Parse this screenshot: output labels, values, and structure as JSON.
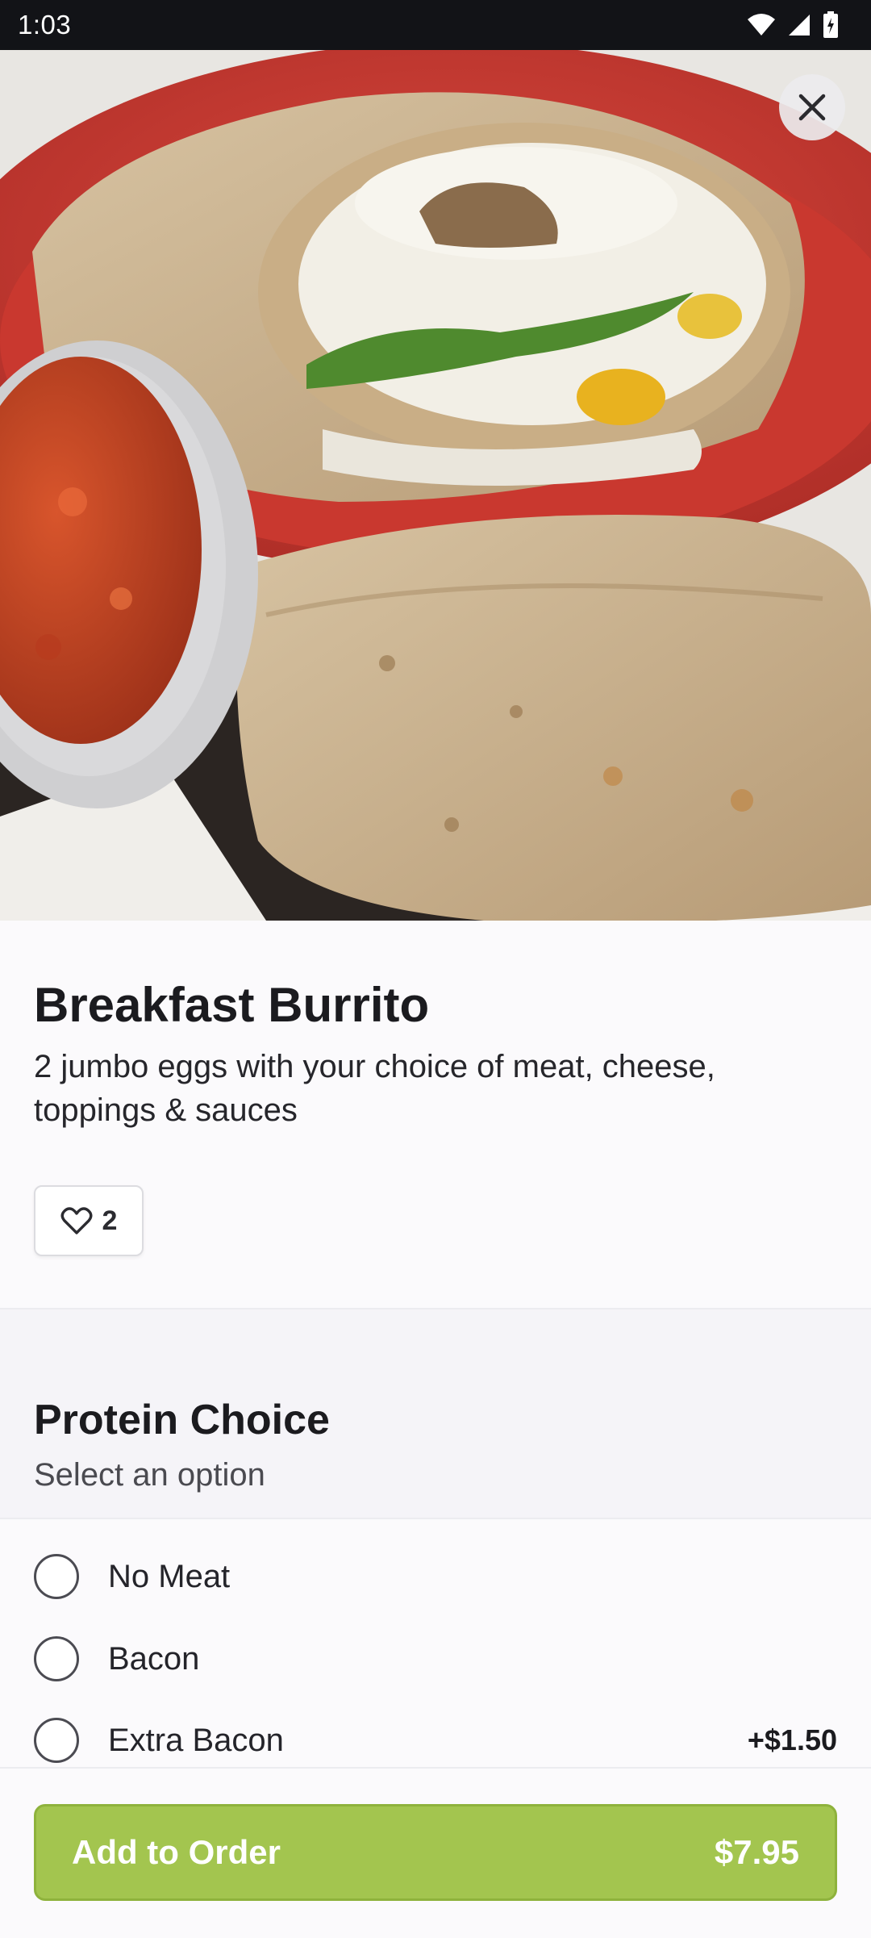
{
  "status_bar": {
    "time": "1:03",
    "icons": [
      "wifi-icon",
      "signal-icon",
      "battery-icon"
    ]
  },
  "hero": {
    "image_icon": "food-photo",
    "close_icon": "close-icon"
  },
  "item": {
    "title": "Breakfast Burrito",
    "description": "2 jumbo eggs with your choice of meat, cheese, toppings & sauces",
    "likes": "2"
  },
  "section": {
    "title": "Protein Choice",
    "subtitle": "Select an option",
    "options": [
      {
        "label": "No Meat",
        "price": ""
      },
      {
        "label": "Bacon",
        "price": ""
      },
      {
        "label": "Extra Bacon",
        "price": "+$1.50"
      }
    ]
  },
  "footer": {
    "add_label": "Add to Order",
    "add_price": "$7.95"
  },
  "colors": {
    "accent": "#a3c54f",
    "status_bar": "#121317",
    "background": "#fbfafc"
  }
}
